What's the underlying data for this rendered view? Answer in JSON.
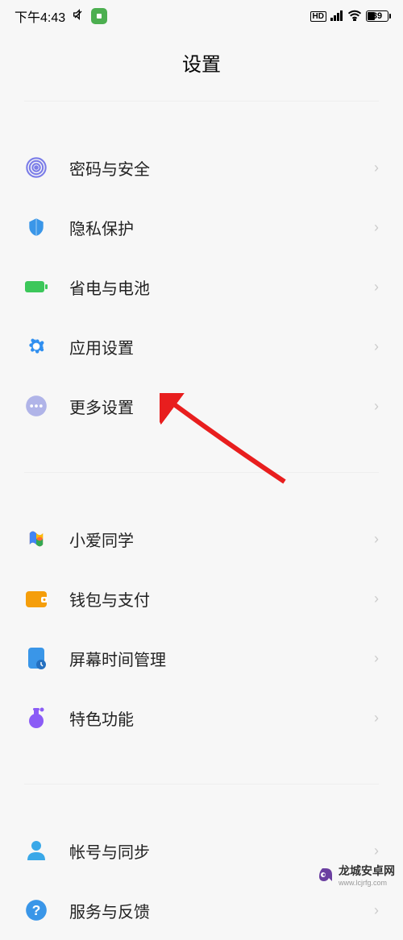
{
  "status": {
    "time": "下午4:43",
    "battery_percent": "39"
  },
  "page": {
    "title": "设置"
  },
  "groups": [
    {
      "items": [
        {
          "icon": "fingerprint",
          "label": "密码与安全"
        },
        {
          "icon": "shield",
          "label": "隐私保护"
        },
        {
          "icon": "battery",
          "label": "省电与电池"
        },
        {
          "icon": "gear",
          "label": "应用设置"
        },
        {
          "icon": "dots",
          "label": "更多设置"
        }
      ]
    },
    {
      "items": [
        {
          "icon": "xiaoai",
          "label": "小爱同学"
        },
        {
          "icon": "wallet",
          "label": "钱包与支付"
        },
        {
          "icon": "screentime",
          "label": "屏幕时间管理"
        },
        {
          "icon": "flask",
          "label": "特色功能"
        }
      ]
    },
    {
      "items": [
        {
          "icon": "account",
          "label": "帐号与同步"
        },
        {
          "icon": "help",
          "label": "服务与反馈"
        }
      ]
    }
  ],
  "watermark": {
    "text": "龙城安卓网",
    "url": "www.lcjrfg.com"
  }
}
